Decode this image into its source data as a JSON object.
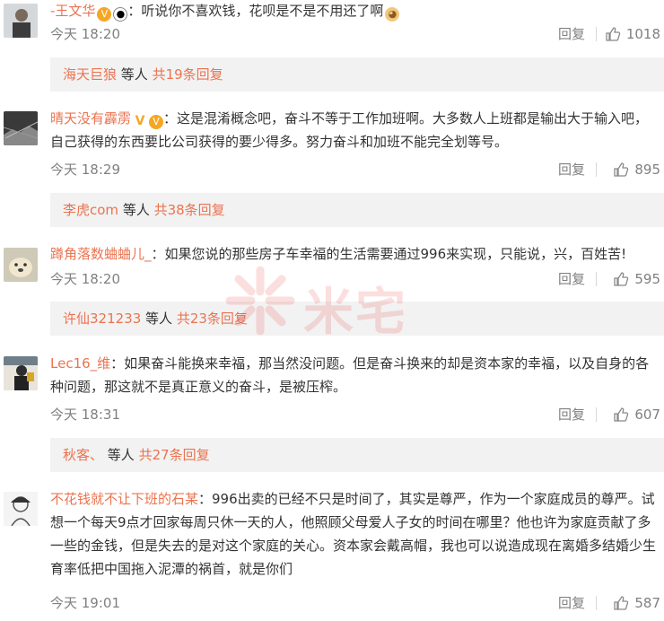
{
  "comments": [
    {
      "name": "-王文华",
      "text": "：听说你不喜欢钱，花呗是不是不用还了啊",
      "time": "今天 18:20",
      "reply_label": "回复",
      "likes": "1018",
      "replies": {
        "who": "海天巨狼",
        "mid": " 等人 ",
        "count": "共19条回复"
      }
    },
    {
      "name": "晴天没有霹雳",
      "text": "：这是混淆概念吧，奋斗不等于工作加班啊。大多数人上班都是输出大于输入吧，自己获得的东西要比公司获得的要少得多。努力奋斗和加班不能完全划等号。",
      "time": "今天 18:29",
      "reply_label": "回复",
      "likes": "895",
      "replies": {
        "who": "李虎com",
        "mid": " 等人 ",
        "count": "共38条回复"
      }
    },
    {
      "name": "蹲角落数蛐蛐儿_",
      "text": "：如果您说的那些房子车幸福的生活需要通过996来实现，只能说，兴，百姓苦!",
      "time": "今天 18:20",
      "reply_label": "回复",
      "likes": "595",
      "replies": {
        "who": "许仙321233",
        "mid": " 等人 ",
        "count": "共23条回复"
      }
    },
    {
      "name": "Lec16_维",
      "text": "：如果奋斗能换来幸福，那当然没问题。但是奋斗换来的却是资本家的幸福，以及自身的各种问题，那这就不是真正意义的奋斗，是被压榨。",
      "time": "今天 18:31",
      "reply_label": "回复",
      "likes": "607",
      "replies": {
        "who": "秋客、",
        "mid": " 等人 ",
        "count": "共27条回复"
      }
    },
    {
      "name": "不花钱就不让下班的石某",
      "text": "：996出卖的已经不只是时间了，其实是尊严，作为一个家庭成员的尊严。试想一个每天9点才回家每周只休一天的人，他照顾父母爱人子女的时间在哪里？他也许为家庭贡献了多一些的金钱，但是失去的是对这个家庭的关心。资本家会戴高帽，我也可以说造成现在离婚多结婚少生育率低把中国拖入泥潭的祸首，就是你们",
      "time": "今天 19:01",
      "reply_label": "回复",
      "likes": "587"
    }
  ],
  "watermark": "米宅",
  "colors": {
    "accent": "#eb7350",
    "meta": "#808080",
    "reply_bg": "#f2f2f2",
    "watermark": "#e83b3b"
  }
}
